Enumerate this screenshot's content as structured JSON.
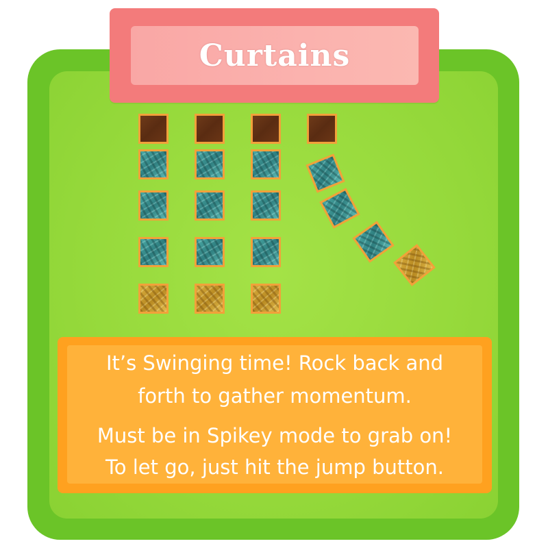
{
  "title": "Curtains",
  "instructions": {
    "line1": "It’s Swinging time! Rock back and",
    "line2": "forth to gather momentum.",
    "line3": "Must be in Spikey mode to grab on!",
    "line4": "To let go, just hit the jump button."
  },
  "colors": {
    "card_outer": "#6bc428",
    "card_inner": "#9bdc40",
    "banner": "#f37b7b",
    "banner_plate": "#faaea9",
    "info_outer": "#ffa11f",
    "info_inner": "#ffb23a",
    "tile_border": "#f2a13a"
  },
  "curtain_columns": [
    {
      "tiles": [
        "brown-anchor-block",
        "teal-block",
        "teal-block",
        "teal-block",
        "gold-block"
      ],
      "state": "hanging"
    },
    {
      "tiles": [
        "brown-anchor-block",
        "teal-block",
        "teal-block",
        "teal-block",
        "gold-block"
      ],
      "state": "hanging"
    },
    {
      "tiles": [
        "brown-anchor-block",
        "teal-block",
        "teal-block",
        "teal-block",
        "gold-block"
      ],
      "state": "hanging"
    },
    {
      "tiles": [
        "brown-anchor-block",
        "teal-block",
        "teal-block",
        "teal-block",
        "gold-block"
      ],
      "state": "swinging"
    }
  ]
}
